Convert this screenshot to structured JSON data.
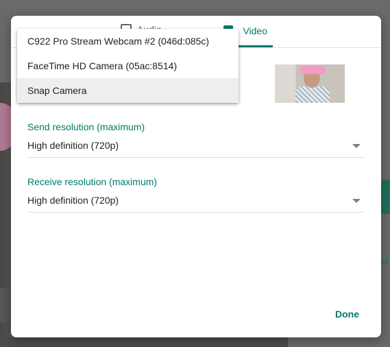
{
  "tabs": {
    "audio_label": "Audio",
    "video_label": "Video"
  },
  "camera_menu": {
    "items": [
      {
        "label": "C922 Pro Stream Webcam #2 (046d:085c)"
      },
      {
        "label": "FaceTime HD Camera (05ac:8514)"
      },
      {
        "label": "Snap Camera",
        "selected": true
      }
    ]
  },
  "send_resolution": {
    "label": "Send resolution (maximum)",
    "value": "High definition (720p)"
  },
  "receive_resolution": {
    "label": "Receive resolution (maximum)",
    "value": "High definition (720p)"
  },
  "actions": {
    "done_label": "Done"
  },
  "colors": {
    "accent": "#00796b",
    "selected_item_bg": "#eeeeee"
  },
  "icons": {
    "audio_tab": "speaker-icon",
    "video_tab": "camera-icon",
    "dropdown": "caret-down-icon"
  }
}
